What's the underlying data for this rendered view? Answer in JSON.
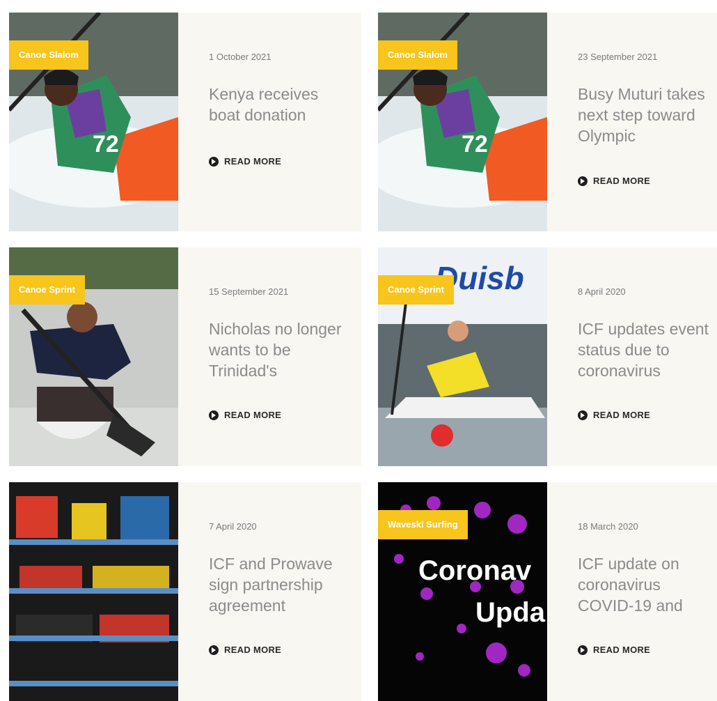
{
  "read_more_label": "READ MORE",
  "articles": [
    {
      "tag": "Canoe Slalom",
      "date": "1 October 2021",
      "title": "Kenya receives boat donation"
    },
    {
      "tag": "Canoe Slalom",
      "date": "23 September 2021",
      "title": "Busy Muturi takes next step toward Olympic"
    },
    {
      "tag": "Canoe Sprint",
      "date": "15 September 2021",
      "title": "Nicholas no longer wants to be Trinidad's"
    },
    {
      "tag": "Canoe Sprint",
      "date": "8 April 2020",
      "title": "ICF updates event status due to coronavirus",
      "image_text": "Duisb"
    },
    {
      "tag": "",
      "date": "7 April 2020",
      "title": "ICF and Prowave sign partnership agreement"
    },
    {
      "tag": "Waveski Surfing",
      "date": "18 March 2020",
      "title": "ICF update on coronavirus COVID-19 and",
      "image_text_1": "Coronav",
      "image_text_2": "Upda"
    }
  ],
  "colors": {
    "tag_bg": "#f7c51b",
    "card_bg": "#f8f7f2",
    "title": "#8b8b8b"
  }
}
